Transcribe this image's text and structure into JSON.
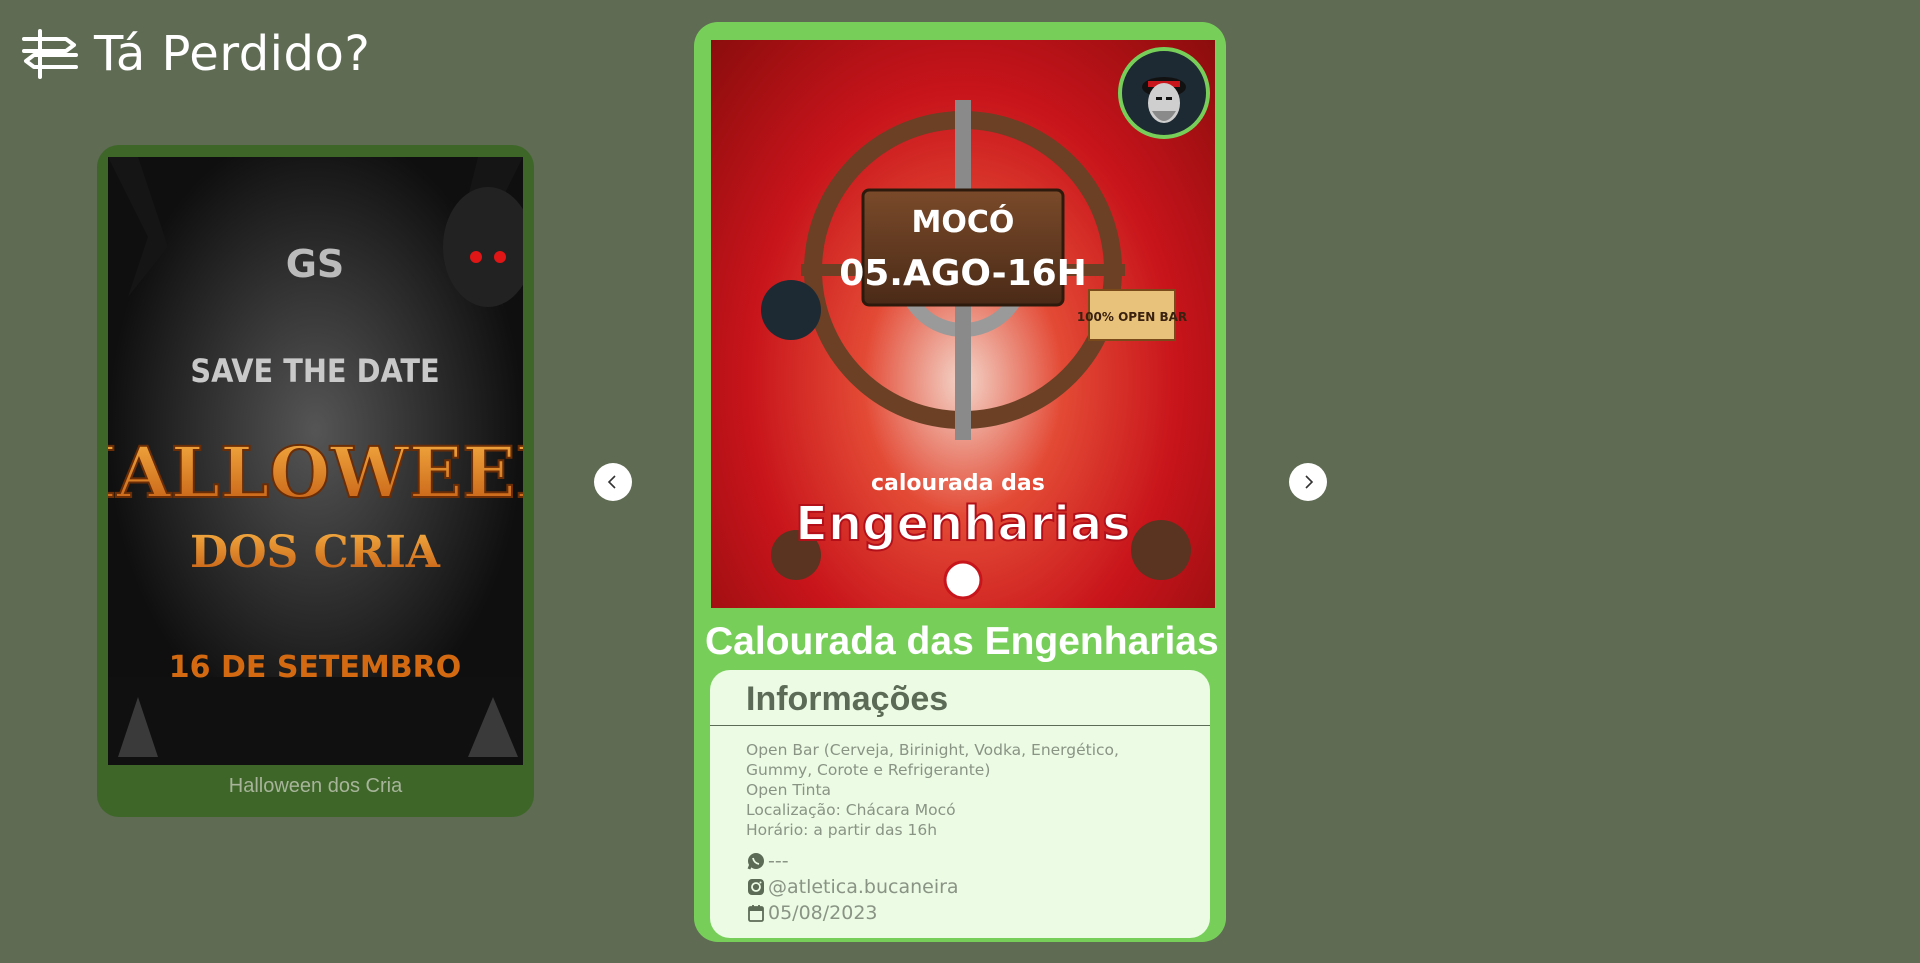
{
  "app": {
    "title": "Tá Perdido?"
  },
  "navigation": {
    "prev_icon": "chevron-left-icon",
    "next_icon": "chevron-right-icon"
  },
  "side_event": {
    "title": "Halloween dos Cria",
    "poster": {
      "brand": "GS",
      "tagline": "SAVE THE DATE",
      "headline": "HALLOWEEN",
      "subheadline": "DOS CRIA",
      "date": "16 DE SETEMBRO"
    }
  },
  "main_event": {
    "title": "Calourada das Engenharias",
    "poster": {
      "location": "MOCÓ",
      "datetime": "05.AGO-16H",
      "badge": "100% OPEN BAR",
      "caption_small": "calourada das",
      "caption_big": "Engenharias"
    },
    "info": {
      "heading": "Informações",
      "lines": [
        "Open Bar (Cerveja, Birinight, Vodka, Energético,",
        "Gummy, Corote e Refrigerante)",
        "Open Tinta",
        "Localização: Chácara Mocó",
        "Horário: a partir das 16h"
      ],
      "whatsapp": "---",
      "instagram": "@atletica.bucaneira",
      "date": "05/08/2023"
    }
  },
  "colors": {
    "background": "#5f6b53",
    "main_card": "#77cf5a",
    "side_card": "#3e6629",
    "info_panel": "#ebfbe4"
  }
}
